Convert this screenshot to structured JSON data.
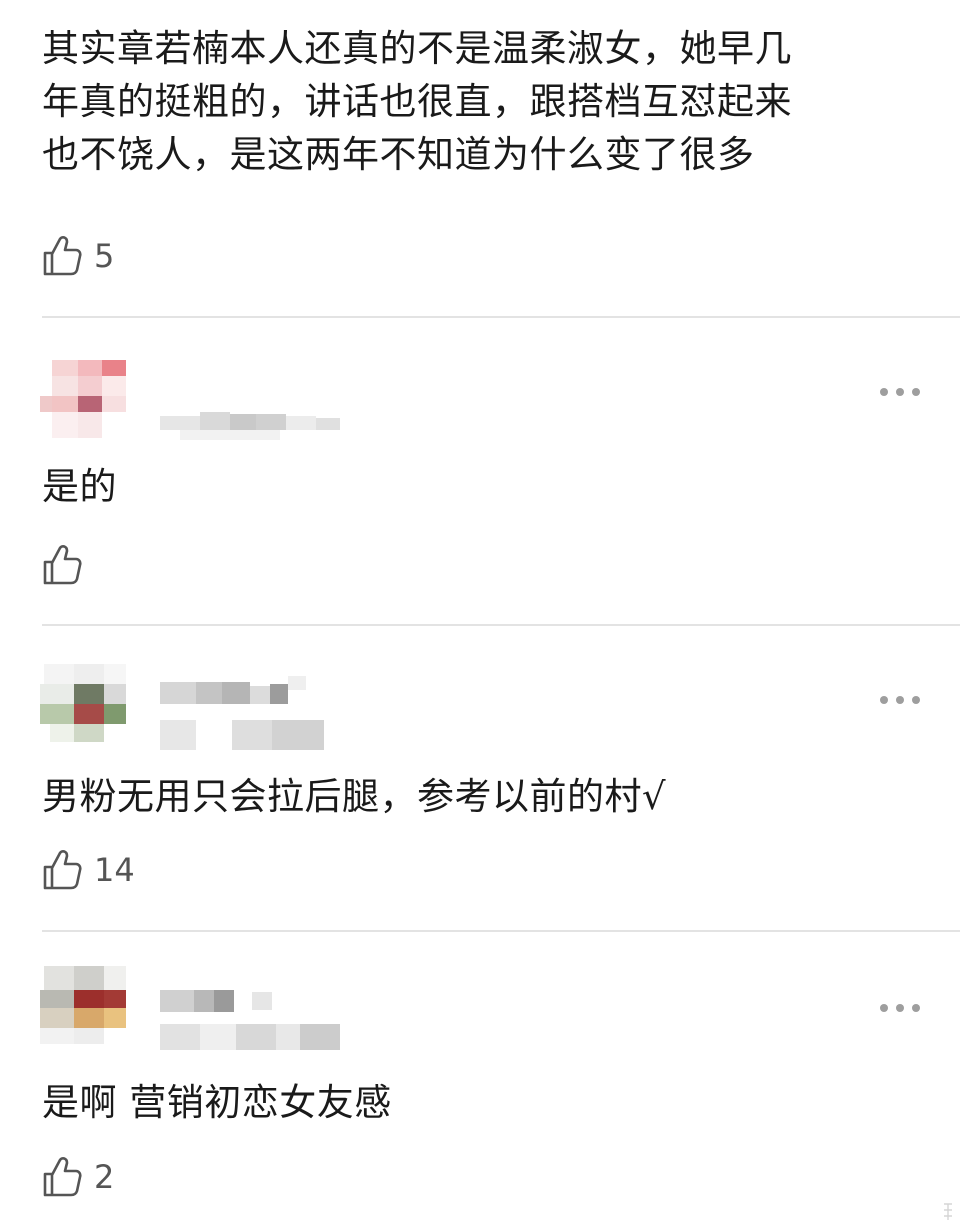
{
  "comments": [
    {
      "text_lines": [
        "其实章若楠本人还真的不是温柔淑女，她早几",
        "年真的挺粗的，讲话也很直，跟搭档互怼起来",
        "也不饶人，是这两年不知道为什么变了很多"
      ],
      "like_count": "5"
    },
    {
      "text": "是的",
      "like_count": ""
    },
    {
      "text": "男粉无用只会拉后腿，参考以前的村√",
      "like_count": "14"
    },
    {
      "text": "是啊 营销初恋女友感",
      "like_count": "2"
    }
  ],
  "icons": {
    "like": "thumbs-up-icon",
    "more": "more-dots-icon"
  },
  "colors": {
    "text": "#1a1a1a",
    "muted": "#555555",
    "divider": "#e3e3e3",
    "dots": "#9e9e9e"
  }
}
